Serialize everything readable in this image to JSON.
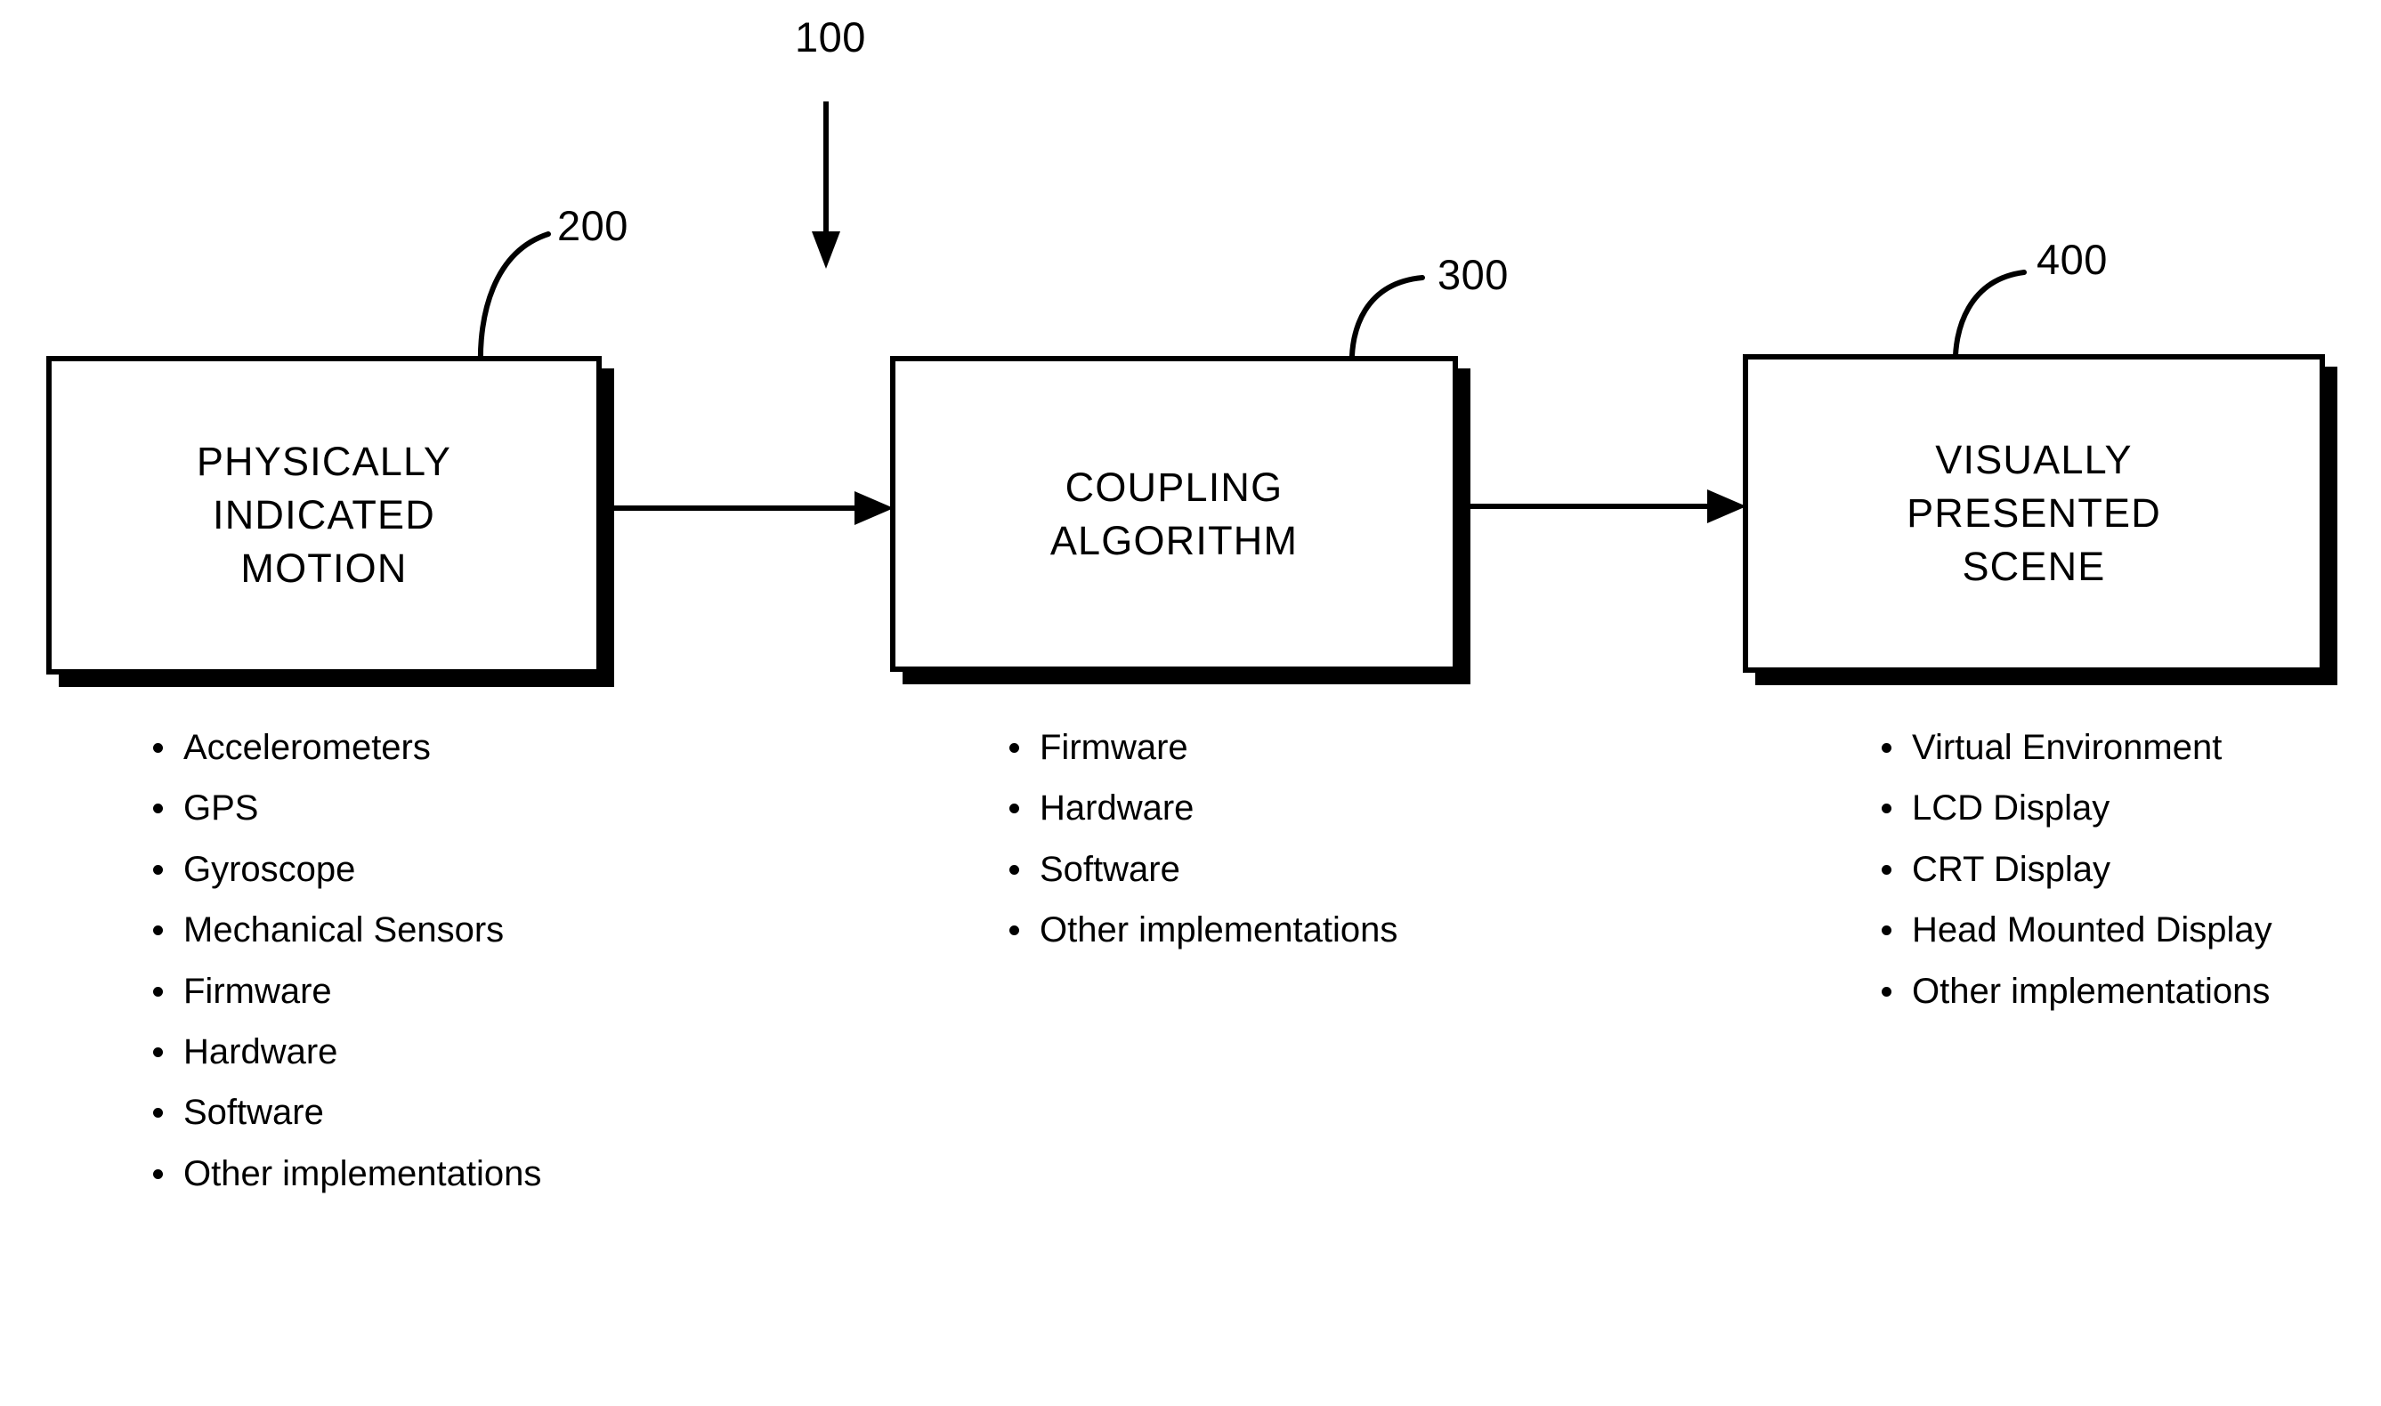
{
  "figure": {
    "system_ref": "100",
    "blocks": [
      {
        "ref": "200",
        "title": "PHYSICALLY\nINDICATED\nMOTION",
        "items": [
          "Accelerometers",
          "GPS",
          "Gyroscope",
          "Mechanical\nSensors",
          "Firmware",
          "Hardware",
          "Software",
          "Other\nimplementations"
        ]
      },
      {
        "ref": "300",
        "title": "COUPLING\nALGORITHM",
        "items": [
          "Firmware",
          "Hardware",
          "Software",
          "Other\nimplementations"
        ]
      },
      {
        "ref": "400",
        "title": "VISUALLY\nPRESENTED\nSCENE",
        "items": [
          "Virtual\nEnvironment",
          "LCD Display",
          "CRT Display",
          "Head Mounted\nDisplay",
          "Other\nimplementations"
        ]
      }
    ],
    "colors": {
      "ink": "#000000",
      "paper": "#ffffff"
    }
  }
}
